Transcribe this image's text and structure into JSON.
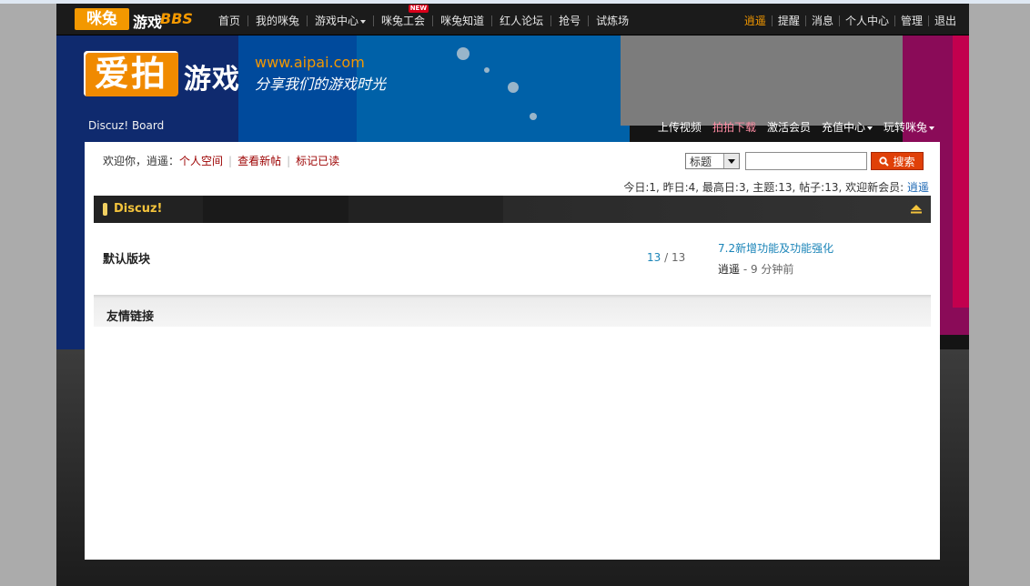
{
  "logo": {
    "brand": "咪兔",
    "game": "游戏",
    "bbs": "BBS"
  },
  "nav": {
    "items": [
      {
        "label": "首页"
      },
      {
        "label": "我的咪兔"
      },
      {
        "label": "游戏中心"
      },
      {
        "label": "咪兔工会",
        "badge": "NEW"
      },
      {
        "label": "咪兔知道"
      },
      {
        "label": "红人论坛"
      },
      {
        "label": "抢号"
      },
      {
        "label": "试炼场"
      }
    ],
    "right": [
      {
        "label": "逍遥"
      },
      {
        "label": "提醒"
      },
      {
        "label": "消息"
      },
      {
        "label": "个人中心"
      },
      {
        "label": "管理"
      },
      {
        "label": "退出"
      }
    ]
  },
  "banner": {
    "logo_text": "爱拍",
    "game_text": "游戏",
    "url": "www.aipai.com",
    "slogan": "分享我们的游戏时光"
  },
  "boardbar": {
    "name": "Discuz! Board",
    "links": [
      {
        "label": "上传视频"
      },
      {
        "label": "拍拍下载"
      },
      {
        "label": "激活会员"
      },
      {
        "label": "充值中心"
      },
      {
        "label": "玩转咪兔"
      }
    ]
  },
  "welcome": {
    "prefix": "欢迎你，逍遥：",
    "links": [
      "个人空间",
      "查看新帖",
      "标记已读"
    ]
  },
  "search": {
    "select_value": "标题",
    "input_value": "",
    "button_label": "搜索"
  },
  "stats": {
    "text": "今日:1, 昨日:4, 最高日:3,  主题:13, 帖子:13, 欢迎新会员: ",
    "new_member": "逍遥"
  },
  "category": {
    "title": "Discuz!"
  },
  "forum": {
    "name": "默认版块",
    "threads": "13",
    "sep": " / ",
    "posts": "13",
    "lastpost_title": "7.2新增功能及功能强化",
    "lastpost_author": "逍遥",
    "lastpost_ago": " - 9 分钟前"
  },
  "friendlinks": {
    "title": "友情链接"
  },
  "colors": {
    "accent": "#f39800",
    "search_button": "#e04008",
    "link_blue": "#1a84b8",
    "link_red": "#9c0000",
    "category_title": "#f3c33c"
  }
}
